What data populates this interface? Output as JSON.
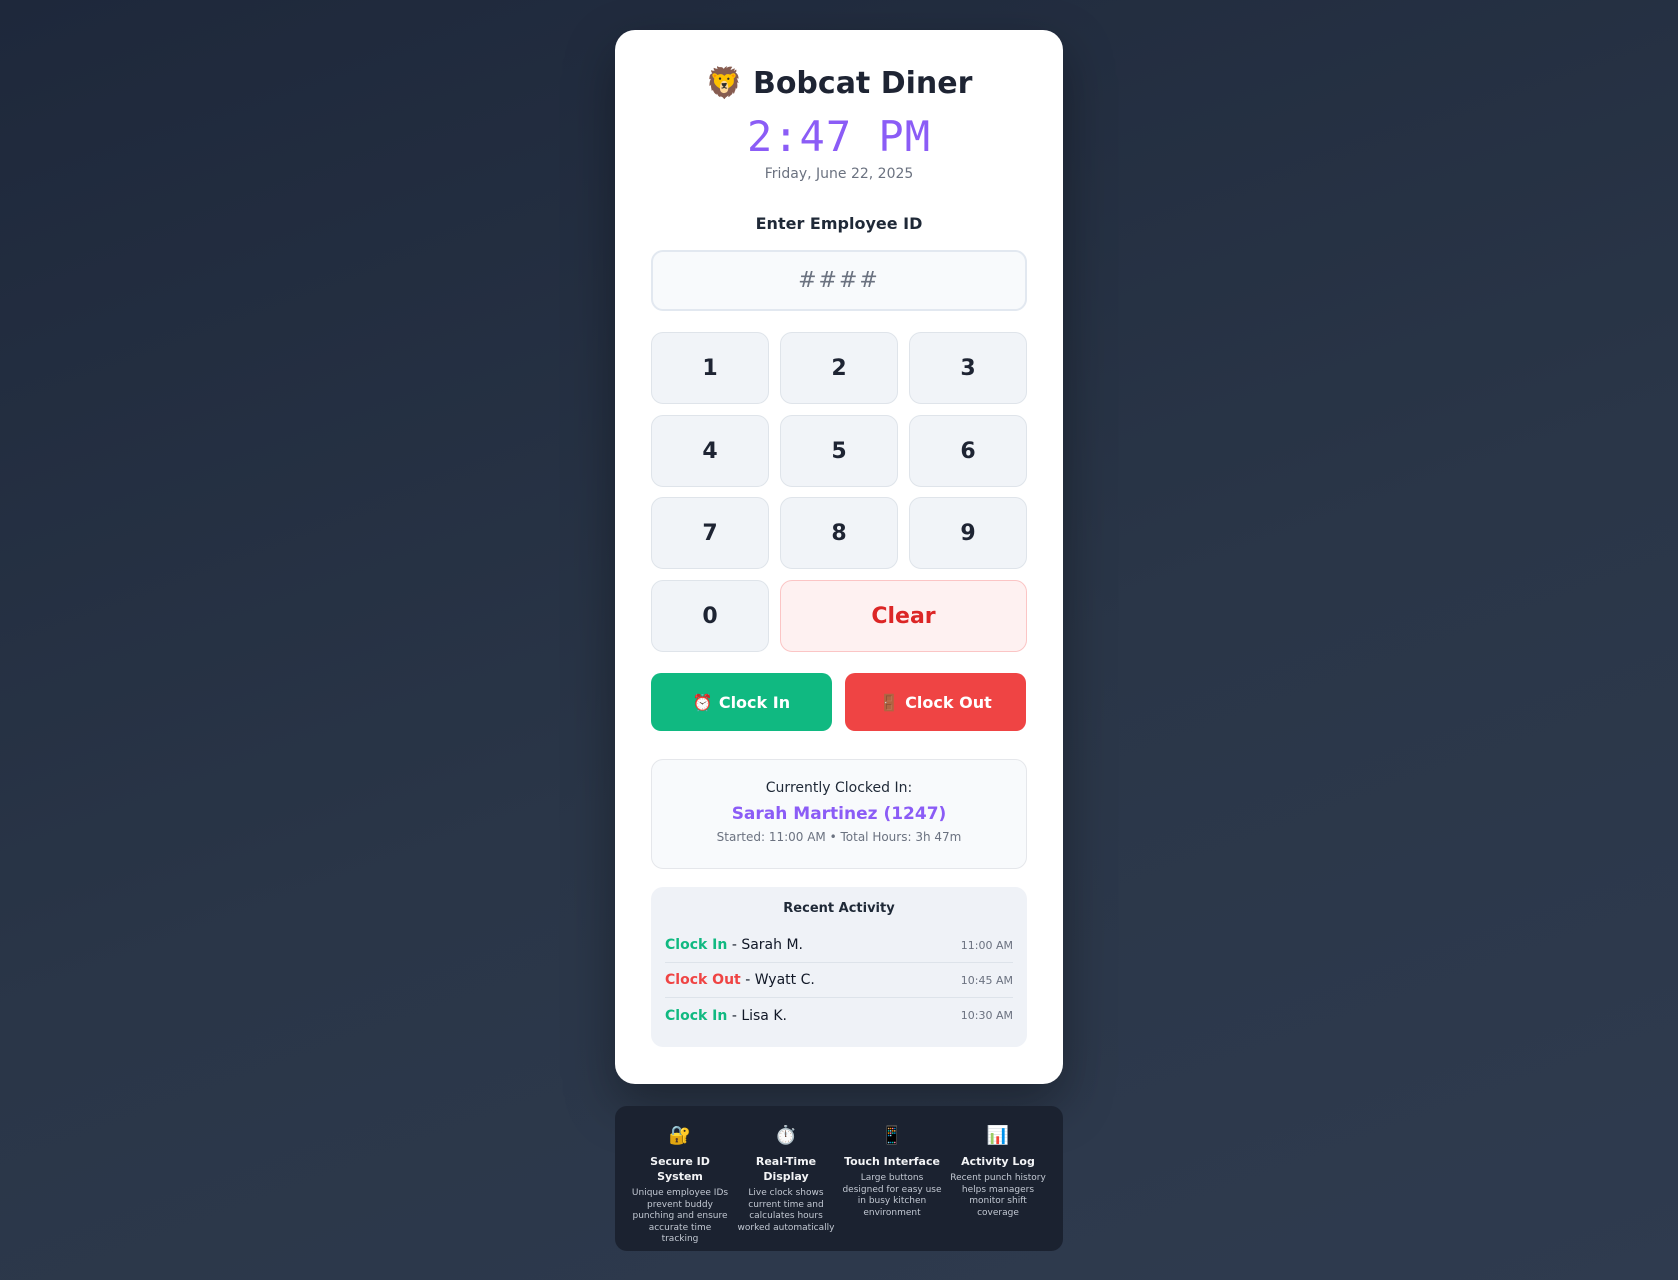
{
  "header": {
    "logo_icon": "🦁",
    "title": "Bobcat Diner",
    "clock": "2:47 PM",
    "date": "Friday, June 22, 2025"
  },
  "entry": {
    "label": "Enter Employee ID",
    "placeholder": "####",
    "value": ""
  },
  "keypad": {
    "keys": [
      "1",
      "2",
      "3",
      "4",
      "5",
      "6",
      "7",
      "8",
      "9",
      "0"
    ],
    "clear_label": "Clear"
  },
  "actions": {
    "clock_in_icon": "⏰",
    "clock_in_label": "Clock In",
    "clock_out_icon": "🚪",
    "clock_out_label": "Clock Out"
  },
  "status": {
    "label": "Currently Clocked In:",
    "name": "Sarah Martinez (1247)",
    "meta": "Started: 11:00 AM • Total Hours: 3h 47m"
  },
  "activity": {
    "title": "Recent Activity",
    "items": [
      {
        "type": "Clock In",
        "name": "- Sarah M.",
        "time": "11:00 AM"
      },
      {
        "type": "Clock Out",
        "name": "- Wyatt C.",
        "time": "10:45 AM"
      },
      {
        "type": "Clock In",
        "name": "- Lisa K.",
        "time": "10:30 AM"
      }
    ]
  },
  "features": [
    {
      "icon": "🔐",
      "title": "Secure ID System",
      "desc": "Unique employee IDs prevent buddy punching and ensure accurate time tracking"
    },
    {
      "icon": "⏱️",
      "title": "Real-Time Display",
      "desc": "Live clock shows current time and calculates hours worked automatically"
    },
    {
      "icon": "📱",
      "title": "Touch Interface",
      "desc": "Large buttons designed for easy use in busy kitchen environment"
    },
    {
      "icon": "📊",
      "title": "Activity Log",
      "desc": "Recent punch history helps managers monitor shift coverage"
    }
  ],
  "colors": {
    "accent": "#8b5cf6",
    "clock_in": "#10b981",
    "clock_out": "#ef4444",
    "clear": "#dc2626"
  }
}
